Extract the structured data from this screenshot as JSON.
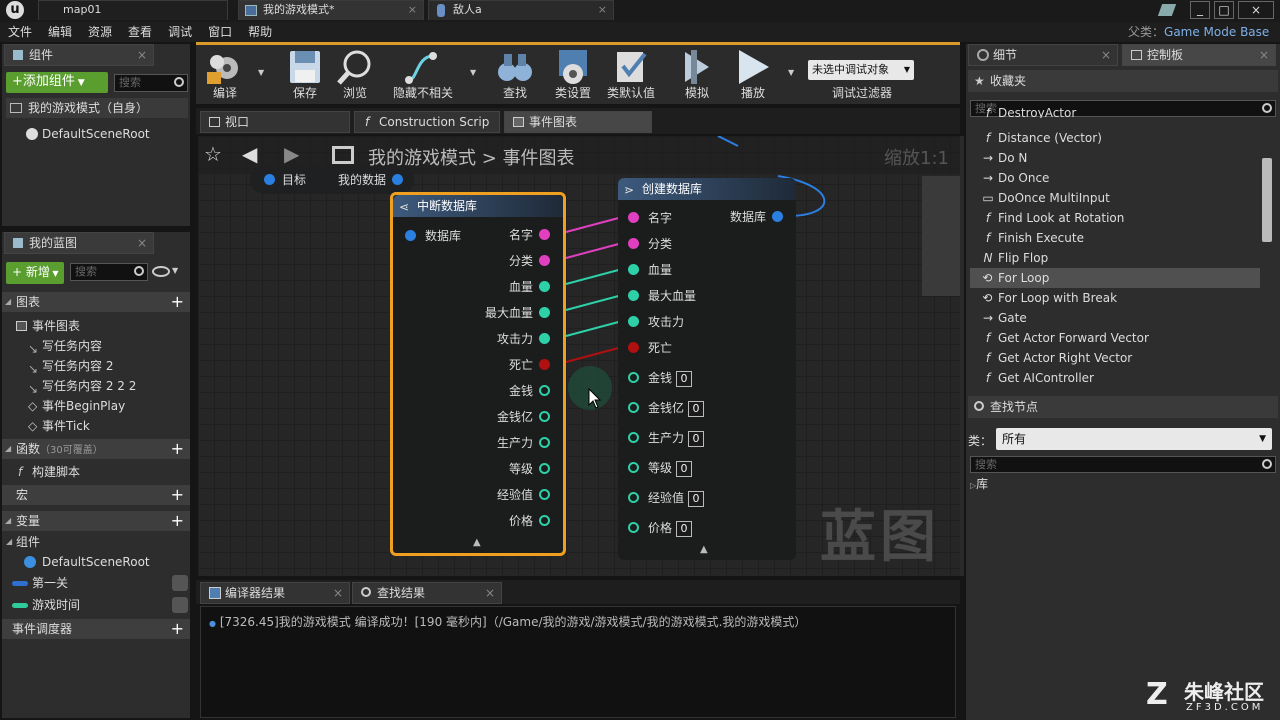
{
  "window_tabs": [
    {
      "label": "map01"
    },
    {
      "label": "我的游戏模式*"
    },
    {
      "label": "敌人a"
    }
  ],
  "parent_class": {
    "label": "父类：",
    "value": "Game Mode Base"
  },
  "menu": [
    "文件",
    "编辑",
    "资源",
    "查看",
    "调试",
    "窗口",
    "帮助"
  ],
  "components_panel": {
    "tab": "组件",
    "add_button": "+添加组件",
    "search_placeholder": "搜索",
    "self_item": "我的游戏模式（自身）",
    "root_item": "DefaultSceneRoot"
  },
  "my_blueprint": {
    "tab": "我的蓝图",
    "new_button": "新增",
    "search_placeholder": "搜索",
    "graphs_header": "图表",
    "event_graph": "事件图表",
    "graph_items": [
      "写任务内容",
      "写任务内容 2",
      "写任务内容 2 2 2",
      "事件BeginPlay",
      "事件Tick"
    ],
    "functions_header": "函数",
    "functions_hint": "（30可覆盖）",
    "construct_script": "构建脚本",
    "macros_header": "宏",
    "variables_header": "变量",
    "components_header": "组件",
    "component_var": "DefaultSceneRoot",
    "variables": [
      "第一关",
      "游戏时间"
    ],
    "dispatchers_header": "事件调度器"
  },
  "toolbar": [
    {
      "label": "编译"
    },
    {
      "label": "保存"
    },
    {
      "label": "浏览"
    },
    {
      "label": "隐藏不相关"
    },
    {
      "label": "查找"
    },
    {
      "label": "类设置"
    },
    {
      "label": "类默认值"
    },
    {
      "label": "模拟"
    },
    {
      "label": "播放"
    }
  ],
  "debug": {
    "select": "未选中调试对象",
    "filter_label": "调试过滤器"
  },
  "editor_tabs": [
    "视口",
    "Construction Scrip",
    "事件图表"
  ],
  "graph": {
    "breadcrumb_root": "我的游戏模式",
    "breadcrumb_sep": ">",
    "breadcrumb_current": "事件图表",
    "zoom": "缩放1:1",
    "watermark": "蓝图",
    "top_node": {
      "target": "目标",
      "data": "我的数据"
    },
    "break_node": {
      "title": "中断数据库",
      "input": "数据库",
      "outputs": [
        "名字",
        "分类",
        "血量",
        "最大血量",
        "攻击力",
        "死亡",
        "金钱",
        "金钱亿",
        "生产力",
        "等级",
        "经验值",
        "价格"
      ]
    },
    "make_node": {
      "title": "创建数据库",
      "output": "数据库",
      "inputs": [
        "名字",
        "分类",
        "血量",
        "最大血量",
        "攻击力",
        "死亡"
      ],
      "value_inputs": [
        {
          "label": "金钱",
          "value": "0"
        },
        {
          "label": "金钱亿",
          "value": "0"
        },
        {
          "label": "生产力",
          "value": "0"
        },
        {
          "label": "等级",
          "value": "0"
        },
        {
          "label": "经验值",
          "value": "0"
        },
        {
          "label": "价格",
          "value": "0"
        }
      ]
    }
  },
  "bottom_tabs": [
    "编译器结果",
    "查找结果"
  ],
  "log_message": "[7326.45]我的游戏模式 编译成功！[190 毫秒内]（/Game/我的游戏/游戏模式/我的游戏模式.我的游戏模式）",
  "right_tabs": [
    "细节",
    "控制板"
  ],
  "favorites": {
    "header": "收藏夹",
    "search_placeholder": "搜索",
    "items": [
      {
        "label": "DestroyActor",
        "icon": "function-icon"
      },
      {
        "label": "Distance (Vector)",
        "icon": "function-icon"
      },
      {
        "label": "Do N",
        "icon": "exec-icon"
      },
      {
        "label": "Do Once",
        "icon": "exec-icon"
      },
      {
        "label": "DoOnce MultiInput",
        "icon": "macro-icon"
      },
      {
        "label": "Find Look at Rotation",
        "icon": "function-icon"
      },
      {
        "label": "Finish Execute",
        "icon": "function-icon"
      },
      {
        "label": "Flip Flop",
        "icon": "flipflop-icon"
      },
      {
        "label": "For Loop",
        "icon": "loop-icon"
      },
      {
        "label": "For Loop with Break",
        "icon": "loop-icon"
      },
      {
        "label": "Gate",
        "icon": "exec-icon"
      },
      {
        "label": "Get Actor Forward Vector",
        "icon": "function-icon"
      },
      {
        "label": "Get Actor Right Vector",
        "icon": "function-icon"
      },
      {
        "label": "Get AIController",
        "icon": "function-icon"
      }
    ],
    "selected_index": 8
  },
  "find_nodes": {
    "header": "查找节点",
    "category_label": "类：",
    "category_value": "所有",
    "search_placeholder": "搜索",
    "library": "库"
  },
  "site_watermark": {
    "name": "朱峰社区",
    "url": "ZF3D.COM"
  }
}
